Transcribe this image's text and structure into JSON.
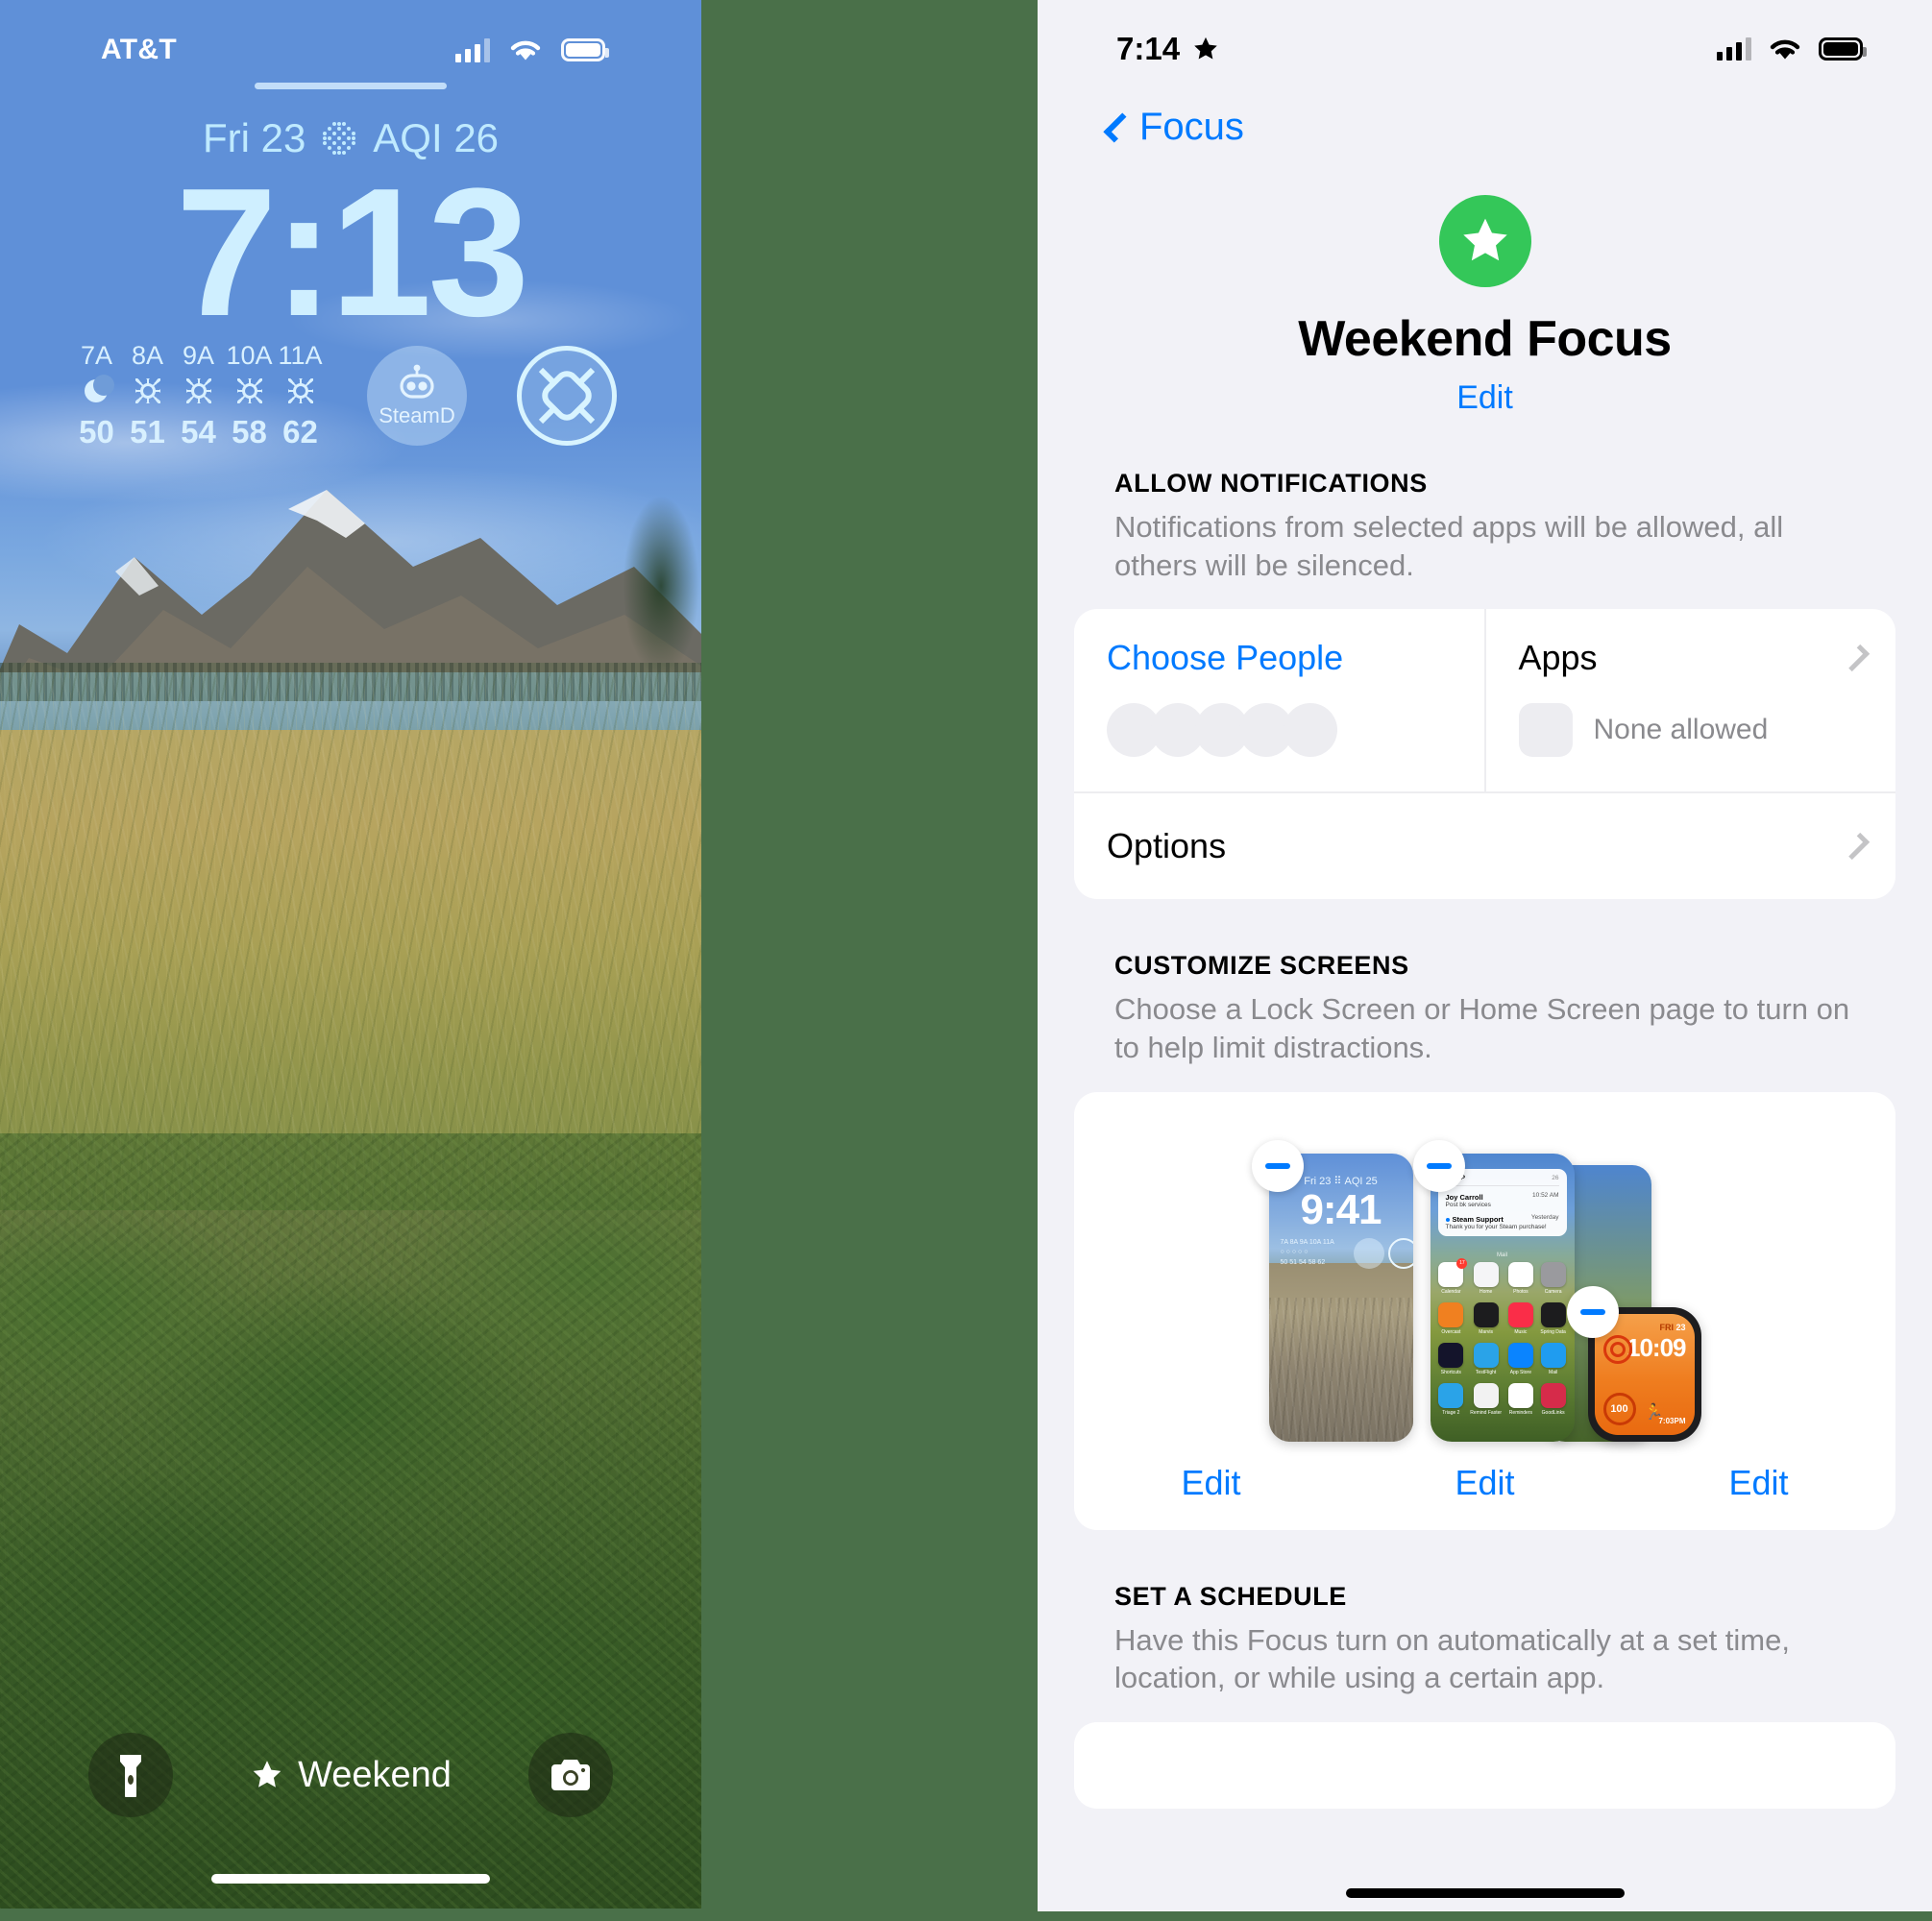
{
  "lock_screen": {
    "status": {
      "carrier": "AT&T",
      "signal_icon": "cellular-bars-icon",
      "wifi_icon": "wifi-icon",
      "battery_icon": "battery-icon"
    },
    "date": "Fri 23",
    "aqi_icon": "aqi-dots-icon",
    "aqi": "AQI 26",
    "time": "7:13",
    "weather": {
      "hours": [
        "7A",
        "8A",
        "9A",
        "10A",
        "11A"
      ],
      "conditions": [
        "moon-stars-icon",
        "sun-icon",
        "sun-icon",
        "sun-icon",
        "sun-icon"
      ],
      "temps": [
        "50",
        "51",
        "54",
        "58",
        "62"
      ]
    },
    "widget_steamd": {
      "label": "SteamD",
      "icon": "robot-icon"
    },
    "widget_lens": {
      "icon": "lens-shutter-icon"
    },
    "flashlight_icon": "flashlight-icon",
    "camera_icon": "camera-icon",
    "focus_pill": {
      "icon": "star-icon",
      "label": "Weekend"
    }
  },
  "settings": {
    "status": {
      "time": "7:14",
      "focus_icon": "star-icon",
      "signal_icon": "cellular-bars-icon",
      "wifi_icon": "wifi-icon",
      "battery_icon": "battery-icon"
    },
    "back_label": "Focus",
    "back_icon": "chevron-left-icon",
    "hero": {
      "badge_icon": "star-icon",
      "badge_color": "#34c759",
      "title": "Weekend Focus",
      "edit_label": "Edit"
    },
    "allow_notifications": {
      "header": "ALLOW NOTIFICATIONS",
      "description": "Notifications from selected apps will be allowed, all others will be silenced.",
      "people": {
        "title": "Choose People",
        "avatar_count": 5
      },
      "apps": {
        "title": "Apps",
        "value": "None allowed",
        "chevron_icon": "chevron-right-icon"
      },
      "options": {
        "title": "Options",
        "chevron_icon": "chevron-right-icon"
      }
    },
    "customize_screens": {
      "header": "CUSTOMIZE SCREENS",
      "description": "Choose a Lock Screen or Home Screen page to turn on to help limit distractions.",
      "lock_preview": {
        "date": "Fri 23",
        "aqi": "AQI 25",
        "time": "9:41",
        "hours": [
          "7A",
          "8A",
          "9A",
          "10A",
          "11A"
        ],
        "temps": [
          "50",
          "51",
          "54",
          "58",
          "62"
        ],
        "remove_icon": "minus-badge-icon",
        "edit_label": "Edit"
      },
      "home_preview": {
        "remove_icon": "minus-badge-icon",
        "edit_label": "Edit",
        "notification": {
          "vip_label": "VIP",
          "vip_icon": "star-icon",
          "count": "26",
          "items": [
            {
              "from": "Joy Carroll",
              "subject": "Post bk services",
              "time": "10:52 AM"
            },
            {
              "from": "Steam Support",
              "subject": "Thank you for your Steam purchase!",
              "time": "Yesterday"
            }
          ]
        },
        "widget_label": "Mail",
        "apps": [
          {
            "name": "Calendar",
            "badge": "17"
          },
          {
            "name": "Home",
            "badge": ""
          },
          {
            "name": "Photos",
            "badge": ""
          },
          {
            "name": "Camera",
            "badge": ""
          },
          {
            "name": "Overcast",
            "badge": ""
          },
          {
            "name": "Marvis",
            "badge": ""
          },
          {
            "name": "Music",
            "badge": ""
          },
          {
            "name": "Spring Data",
            "badge": ""
          },
          {
            "name": "Shortcuts",
            "badge": ""
          },
          {
            "name": "TestFlight",
            "badge": ""
          },
          {
            "name": "App Store",
            "badge": ""
          },
          {
            "name": "Mail",
            "badge": ""
          },
          {
            "name": "Triage 2",
            "badge": ""
          },
          {
            "name": "Remind Faster",
            "badge": ""
          },
          {
            "name": "Reminders",
            "badge": ""
          },
          {
            "name": "GoodLinks",
            "badge": ""
          }
        ]
      },
      "watch_preview": {
        "remove_icon": "minus-badge-icon",
        "edit_label": "Edit",
        "date_day": "FRI",
        "date_num": "23",
        "time": "10:09",
        "rings_icon": "activity-rings-icon",
        "complication_steps": "100",
        "complication_workout_icon": "running-icon",
        "complication_sunset": "7:03",
        "complication_sunset_unit": "PM"
      }
    },
    "set_a_schedule": {
      "header": "SET A SCHEDULE",
      "description": "Have this Focus turn on automatically at a set time, location, or while using a certain app."
    }
  },
  "colors": {
    "accent_blue": "#007aff",
    "focus_green": "#34c759",
    "page_background": "#f2f2f7",
    "canvas_background": "#4a7049"
  }
}
